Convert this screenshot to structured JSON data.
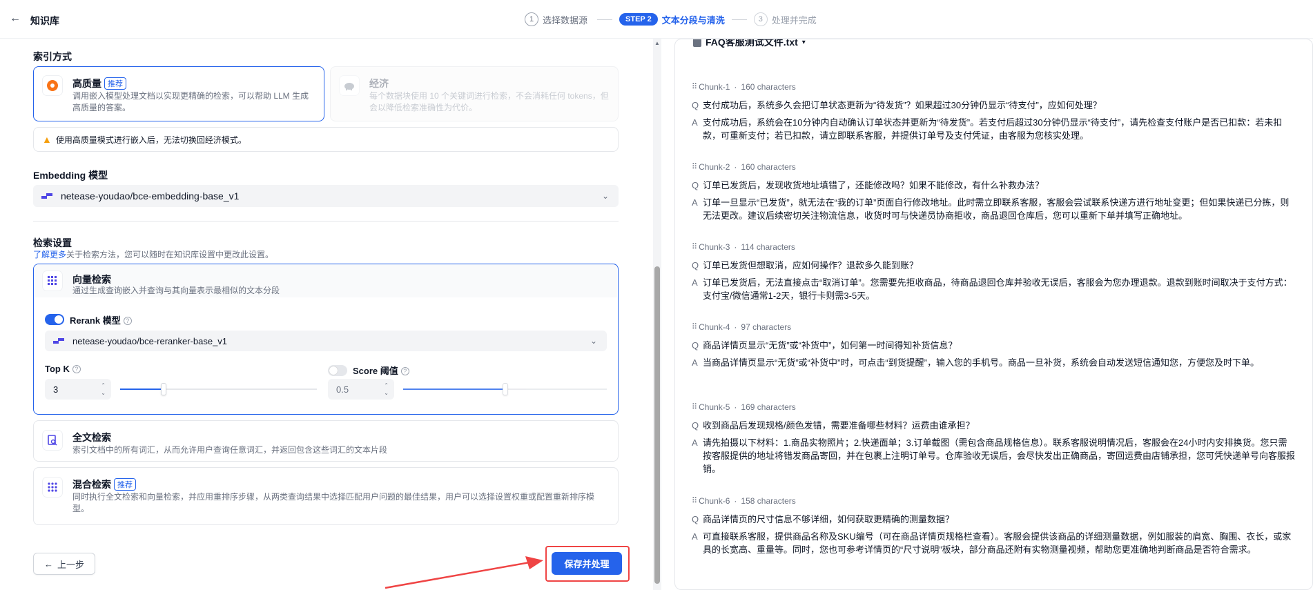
{
  "header": {
    "title": "知识库",
    "steps": [
      {
        "num": "1",
        "label": "选择数据源"
      },
      {
        "pill": "STEP 2",
        "label": "文本分段与清洗"
      },
      {
        "num": "3",
        "label": "处理并完成"
      }
    ]
  },
  "index_method": {
    "title": "索引方式",
    "high_quality": {
      "title": "高质量",
      "badge": "推荐",
      "desc": "调用嵌入模型处理文档以实现更精确的检索，可以帮助 LLM 生成高质量的答案。"
    },
    "economy": {
      "title": "经济",
      "desc": "每个数据块使用 10 个关键词进行检索，不会消耗任何 tokens，但会以降低检索准确性为代价。"
    },
    "warning": "使用高质量模式进行嵌入后，无法切换回经济模式。"
  },
  "embedding": {
    "title": "Embedding 模型",
    "model": "netease-youdao/bce-embedding-base_v1"
  },
  "retrieval": {
    "title": "检索设置",
    "learn_more": "了解更多",
    "hint": "关于检索方法，您可以随时在知识库设置中更改此设置。",
    "vector": {
      "title": "向量检索",
      "desc": "通过生成查询嵌入并查询与其向量表示最相似的文本分段"
    },
    "rerank": {
      "label": "Rerank 模型",
      "enabled": true,
      "model": "netease-youdao/bce-reranker-base_v1"
    },
    "top_k": {
      "label": "Top K",
      "value": "3",
      "slider_fraction": 0.22
    },
    "score": {
      "label": "Score 阈值",
      "enabled": false,
      "value": "0.5",
      "slider_fraction": 0.5
    },
    "fulltext": {
      "title": "全文检索",
      "desc": "索引文档中的所有词汇，从而允许用户查询任意词汇，并返回包含这些词汇的文本片段"
    },
    "hybrid": {
      "title": "混合检索",
      "badge": "推荐",
      "desc": "同时执行全文检索和向量检索，并应用重排序步骤，从两类查询结果中选择匹配用户问题的最佳结果，用户可以选择设置权重或配置重新排序模型。"
    }
  },
  "actions": {
    "prev": "上一步",
    "save": "保存并处理"
  },
  "preview": {
    "file_name": "FAQ客服测试文件.txt",
    "chunks": [
      {
        "id": "Chunk-1",
        "chars": "160 characters",
        "q": "支付成功后，系统多久会把订单状态更新为“待发货”？如果超过30分钟仍显示“待支付”，应如何处理？",
        "a": "支付成功后，系统会在10分钟内自动确认订单状态并更新为“待发货”。若支付后超过30分钟仍显示“待支付”，请先检查支付账户是否已扣款：若未扣款，可重新支付；若已扣款，请立即联系客服，并提供订单号及支付凭证，由客服为您核实处理。"
      },
      {
        "id": "Chunk-2",
        "chars": "160 characters",
        "q": "订单已发货后，发现收货地址填错了，还能修改吗？如果不能修改，有什么补救办法？",
        "a": "订单一旦显示“已发货”，就无法在“我的订单”页面自行修改地址。此时需立即联系客服，客服会尝试联系快递方进行地址变更；但如果快递已分拣，则无法更改。建议后续密切关注物流信息，收货时可与快递员协商拒收，商品退回仓库后，您可以重新下单并填写正确地址。"
      },
      {
        "id": "Chunk-3",
        "chars": "114 characters",
        "q": "订单已发货但想取消，应如何操作？退款多久能到账？",
        "a": "订单已发货后，无法直接点击“取消订单”。您需要先拒收商品，待商品退回仓库并验收无误后，客服会为您办理退款。退款到账时间取决于支付方式：支付宝/微信通常1-2天，银行卡则需3-5天。"
      },
      {
        "id": "Chunk-4",
        "chars": "97 characters",
        "q": "商品详情页显示“无货”或“补货中”，如何第一时间得知补货信息？",
        "a": "当商品详情页显示“无货”或“补货中”时，可点击“到货提醒”，输入您的手机号。商品一旦补货，系统会自动发送短信通知您，方便您及时下单。"
      },
      {
        "id": "Chunk-5",
        "chars": "169 characters",
        "q": "收到商品后发现规格/颜色发错，需要准备哪些材料？运费由谁承担？",
        "a": "请先拍摄以下材料：1.商品实物照片；2.快递面单；3.订单截图（需包含商品规格信息）。联系客服说明情况后，客服会在24小时内安排换货。您只需按客服提供的地址将错发商品寄回，并在包裹上注明订单号。仓库验收无误后，会尽快发出正确商品，寄回运费由店铺承担，您可凭快递单号向客服报销。"
      },
      {
        "id": "Chunk-6",
        "chars": "158 characters",
        "q": "商品详情页的尺寸信息不够详细，如何获取更精确的测量数据？",
        "a": "可直接联系客服，提供商品名称及SKU编号（可在商品详情页规格栏查看）。客服会提供该商品的详细测量数据，例如服装的肩宽、胸围、衣长，或家具的长宽高、重量等。同时，您也可参考详情页的“尺寸说明”板块，部分商品还附有实物测量视频，帮助您更准确地判断商品是否符合需求。"
      }
    ]
  },
  "icons": {
    "back": "arrow-left-icon",
    "high_quality": "sparkle-icon",
    "economy": "piggy-bank-icon",
    "warning": "warning-triangle-icon",
    "vector": "grid-icon",
    "fulltext": "document-search-icon",
    "hybrid": "dots-grid-icon"
  },
  "colors": {
    "accent": "#2563eb",
    "warning": "#f59e0b",
    "highlight_box": "#ef4444",
    "high_quality_icon": "#f97316"
  }
}
